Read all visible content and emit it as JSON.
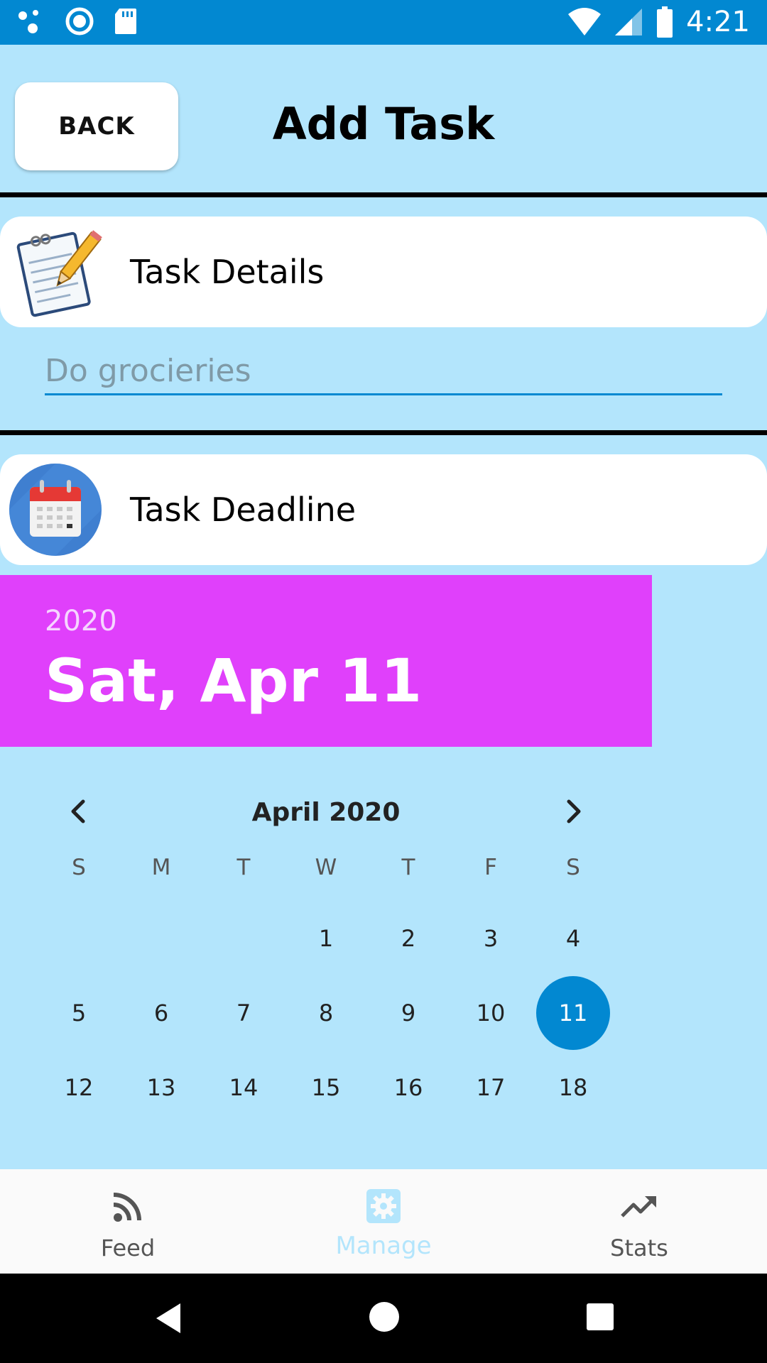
{
  "status_bar": {
    "time": "4:21"
  },
  "header": {
    "back_label": "BACK",
    "title": "Add Task"
  },
  "task_details": {
    "label": "Task Details",
    "icon": "notepad-pencil-icon",
    "input_placeholder": "Do grocieries",
    "input_value": ""
  },
  "task_deadline": {
    "label": "Task Deadline",
    "icon": "calendar-icon"
  },
  "date_picker": {
    "year": "2020",
    "selected_date": "Sat, Apr 11",
    "month_label": "April 2020",
    "weekdays": [
      "S",
      "M",
      "T",
      "W",
      "T",
      "F",
      "S"
    ],
    "weeks": [
      [
        "",
        "",
        "",
        "1",
        "2",
        "3",
        "4"
      ],
      [
        "5",
        "6",
        "7",
        "8",
        "9",
        "10",
        "11"
      ],
      [
        "12",
        "13",
        "14",
        "15",
        "16",
        "17",
        "18"
      ]
    ],
    "selected_day": "11",
    "header_color": "#e040fb",
    "selection_color": "#0288d1"
  },
  "bottom_nav": {
    "items": [
      {
        "label": "Feed",
        "icon": "rss-feed-icon"
      },
      {
        "label": "Manage",
        "icon": "gear-icon",
        "active": true
      },
      {
        "label": "Stats",
        "icon": "trending-up-icon"
      }
    ]
  },
  "colors": {
    "background": "#b3e5fc",
    "status_bar": "#0288d1"
  }
}
